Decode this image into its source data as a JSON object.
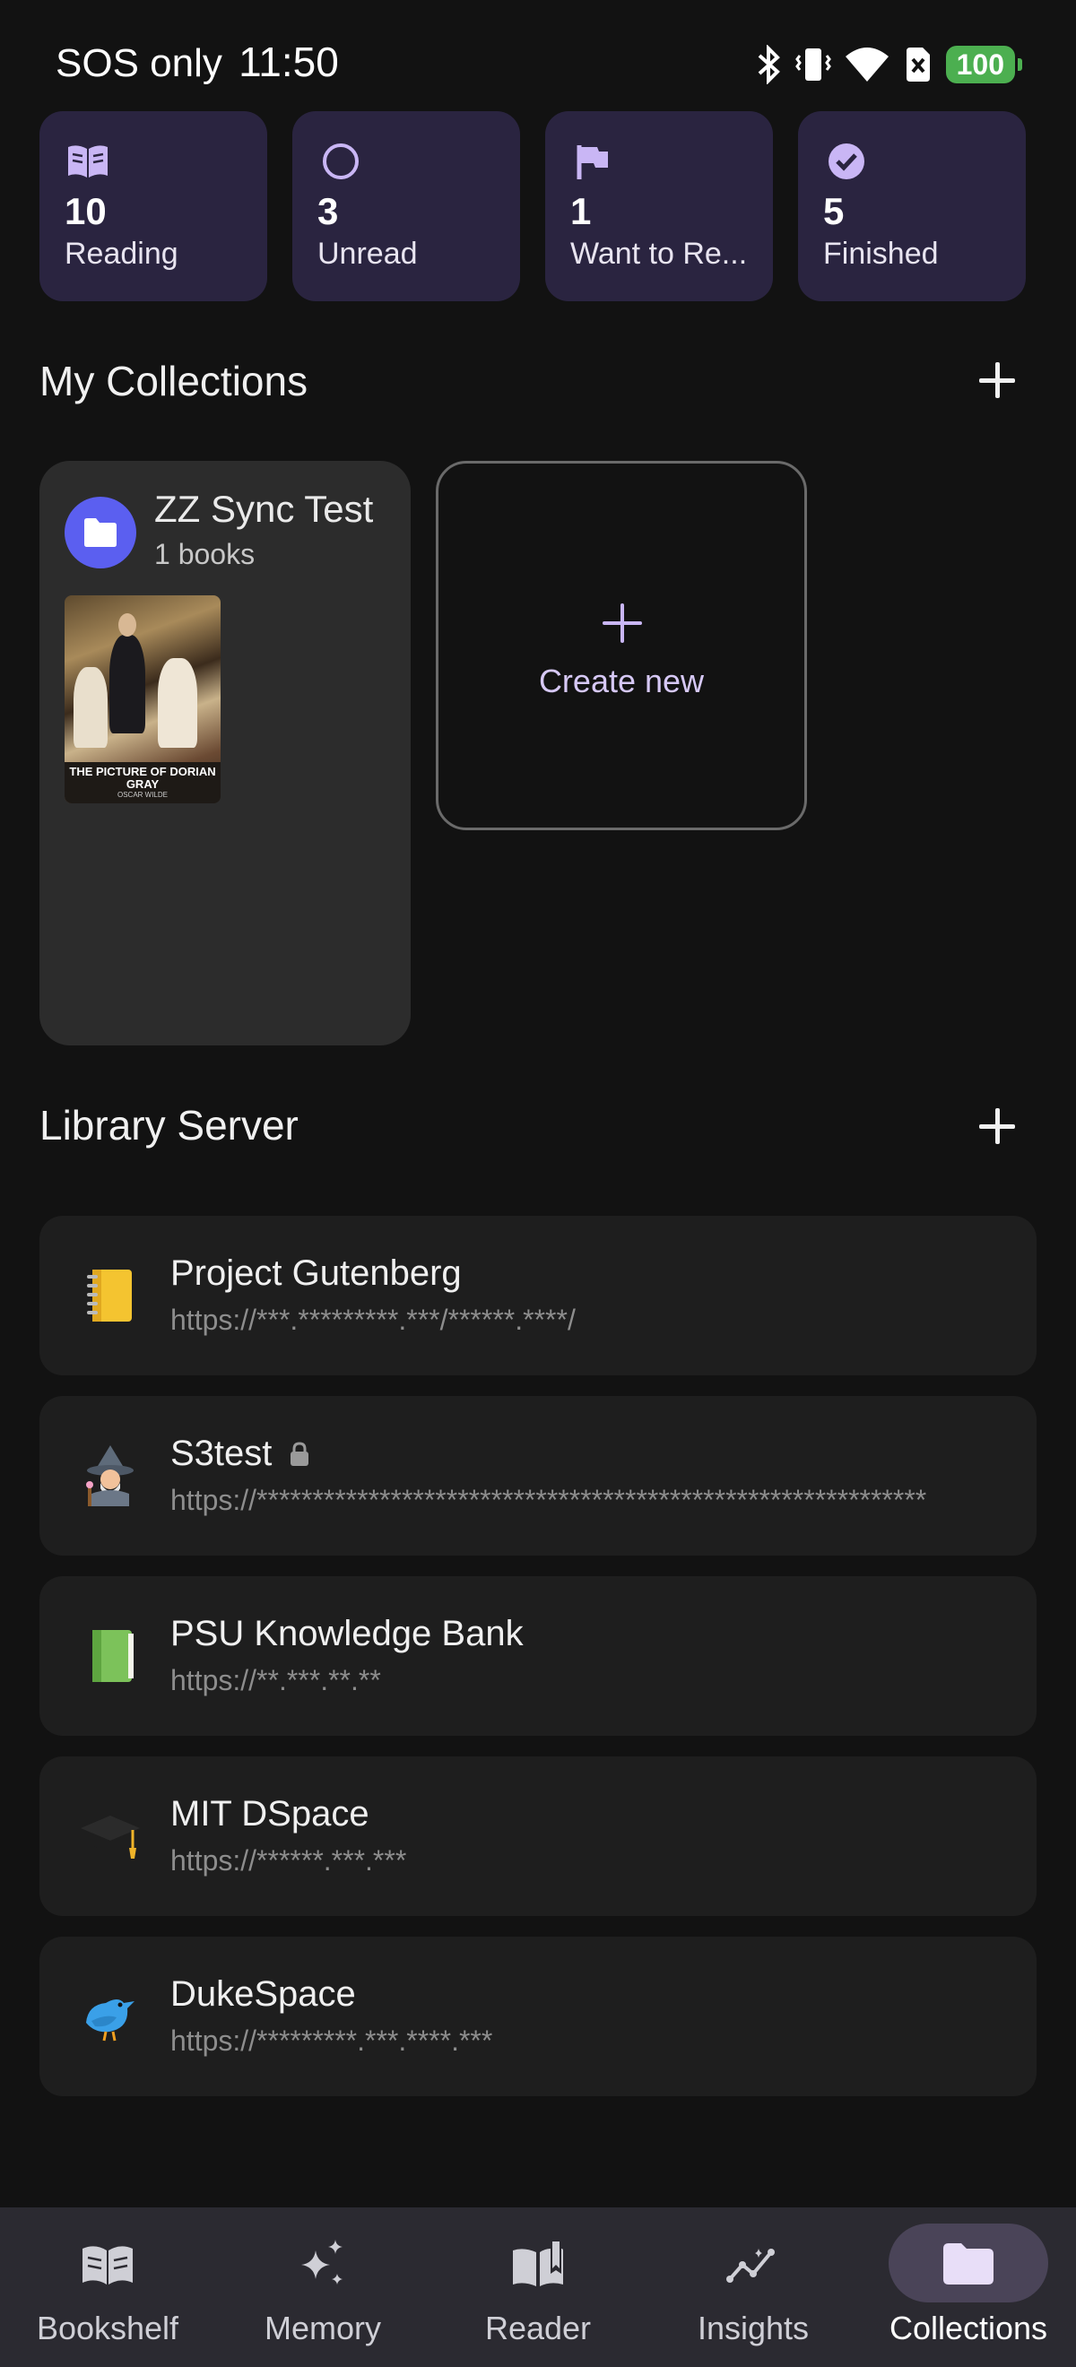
{
  "status_bar": {
    "carrier": "SOS only",
    "time": "11:50",
    "battery": "100"
  },
  "stats": [
    {
      "icon": "book-icon",
      "count": "10",
      "label": "Reading"
    },
    {
      "icon": "circle-icon",
      "count": "3",
      "label": "Unread"
    },
    {
      "icon": "flag-icon",
      "count": "1",
      "label": "Want to Re..."
    },
    {
      "icon": "check-circle-icon",
      "count": "5",
      "label": "Finished"
    }
  ],
  "collections": {
    "title": "My Collections",
    "items": [
      {
        "name": "ZZ Sync Test",
        "count": "1 books",
        "book_title": "THE PICTURE OF DORIAN GRAY",
        "book_author": "OSCAR WILDE"
      }
    ],
    "create_label": "Create new"
  },
  "library_server": {
    "title": "Library Server",
    "servers": [
      {
        "emoji": "📒",
        "name": "Project Gutenberg",
        "url": "https://***.*********.***/******.****/",
        "locked": false
      },
      {
        "emoji": "🧙",
        "name": "S3test",
        "url": "https://************************************************************",
        "locked": true
      },
      {
        "emoji": "📗",
        "name": "PSU Knowledge Bank",
        "url": "https://**.***.**.**",
        "locked": false
      },
      {
        "emoji": "🎓",
        "name": "MIT DSpace",
        "url": "https://******.***.***",
        "locked": false
      },
      {
        "emoji": "🐦",
        "name": "DukeSpace",
        "url": "https://*********.***.****.***",
        "locked": false
      }
    ]
  },
  "nav": [
    {
      "icon": "book-open-icon",
      "label": "Bookshelf",
      "active": false
    },
    {
      "icon": "sparkles-icon",
      "label": "Memory",
      "active": false
    },
    {
      "icon": "reader-icon",
      "label": "Reader",
      "active": false
    },
    {
      "icon": "insights-icon",
      "label": "Insights",
      "active": false
    },
    {
      "icon": "folder-icon",
      "label": "Collections",
      "active": true
    }
  ]
}
